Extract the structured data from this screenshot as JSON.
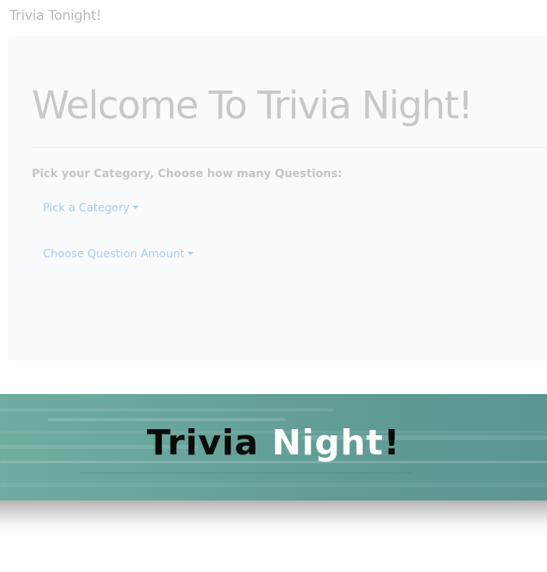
{
  "navbar": {
    "brand": "Trivia Tonight!"
  },
  "main": {
    "title": "Welcome To Trivia Night!",
    "prompt": "Pick your Category, Choose how many Questions:",
    "category_dropdown": {
      "label": "Pick a Category"
    },
    "amount_dropdown": {
      "label": "Choose Question Amount"
    }
  },
  "banner": {
    "text_part1": "Trivia ",
    "text_part2": "Night",
    "text_part3": "!"
  },
  "colors": {
    "banner_teal": "#5f9a94",
    "link_blue": "#a9ccf2",
    "jumbotron_bg": "#f9fafc"
  }
}
